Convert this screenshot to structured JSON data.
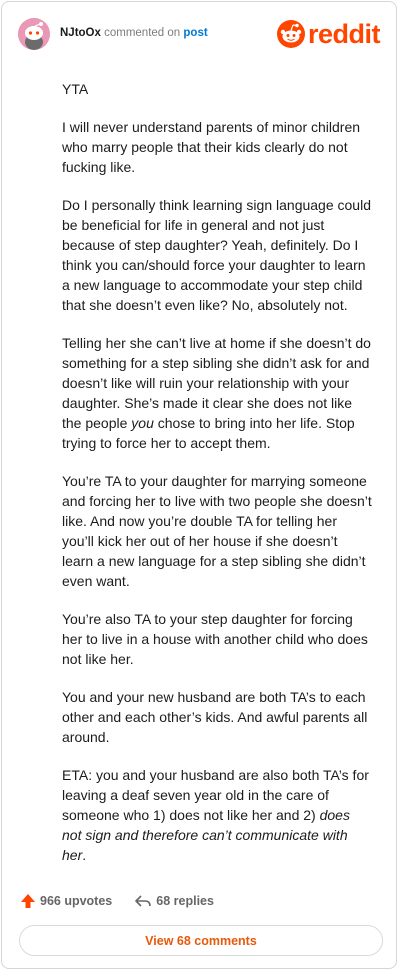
{
  "header": {
    "username": "NJtoOx",
    "action_text": "commented on",
    "post_link": "post",
    "logo_text": "reddit"
  },
  "comment": {
    "paragraphs": [
      [
        {
          "t": "YTA"
        }
      ],
      [
        {
          "t": "I will never understand parents of minor children who marry people that their kids clearly do not fucking like."
        }
      ],
      [
        {
          "t": "Do I personally think learning sign language could be beneficial for life in general and not just because of step daughter? Yeah, definitely. Do I think you can/should force your daughter to learn a new language to accommodate your step child that she doesn’t even like? No, absolutely not."
        }
      ],
      [
        {
          "t": "Telling her she can’t live at home if she doesn’t do something for a step sibling she didn’t ask for and doesn’t like will ruin your relationship with your daughter. She’s made it clear she does not like the people "
        },
        {
          "t": "you",
          "i": true
        },
        {
          "t": " chose to bring into her life. Stop trying to force her to accept them."
        }
      ],
      [
        {
          "t": "You’re TA to your daughter for marrying someone and forcing her to live with two people she doesn’t like. And now you’re double TA for telling her you’ll kick her out of her house if she doesn’t learn a new language for a step sibling she didn’t even want."
        }
      ],
      [
        {
          "t": "You’re also TA to your step daughter for forcing her to live in a house with another child who does not like her."
        }
      ],
      [
        {
          "t": "You and your new husband are both TA’s to each other and each other’s kids. And awful parents all around."
        }
      ],
      [
        {
          "t": "ETA: you and your husband are also both TA’s for leaving a deaf seven year old in the care of someone who 1) does not like her and 2) "
        },
        {
          "t": "does not sign and therefore can’t communicate with her",
          "i": true
        },
        {
          "t": "."
        }
      ]
    ]
  },
  "actions": {
    "upvotes": "966 upvotes",
    "replies": "68 replies",
    "view_comments": "View 68 comments"
  },
  "colors": {
    "brand": "#ff4500",
    "link": "#0079d3",
    "avatar_bg": "#ea98b6"
  },
  "icons": {
    "avatar": "snoo-avatar-icon",
    "logo": "reddit-snoo-icon",
    "upvote": "upvote-arrow-icon",
    "reply": "reply-arrow-icon"
  }
}
